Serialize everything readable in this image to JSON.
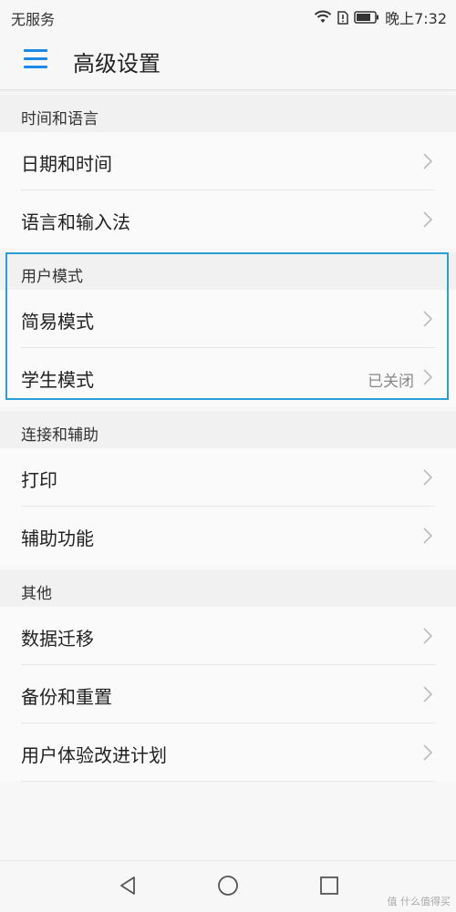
{
  "status_bar": {
    "carrier": "无服务",
    "time": "晚上7:32"
  },
  "toolbar": {
    "title": "高级设置"
  },
  "sections": [
    {
      "header": "时间和语言",
      "items": [
        {
          "label": "日期和时间"
        },
        {
          "label": "语言和输入法"
        }
      ]
    },
    {
      "header": "用户模式",
      "items": [
        {
          "label": "简易模式"
        },
        {
          "label": "学生模式",
          "value": "已关闭"
        }
      ]
    },
    {
      "header": "连接和辅助",
      "items": [
        {
          "label": "打印"
        },
        {
          "label": "辅助功能"
        }
      ]
    },
    {
      "header": "其他",
      "items": [
        {
          "label": "数据迁移"
        },
        {
          "label": "备份和重置"
        },
        {
          "label": "用户体验改进计划"
        }
      ]
    }
  ],
  "colors": {
    "accent": "#1e88e5",
    "highlight": "#2a9ed6"
  },
  "watermark": "值 什么值得买"
}
